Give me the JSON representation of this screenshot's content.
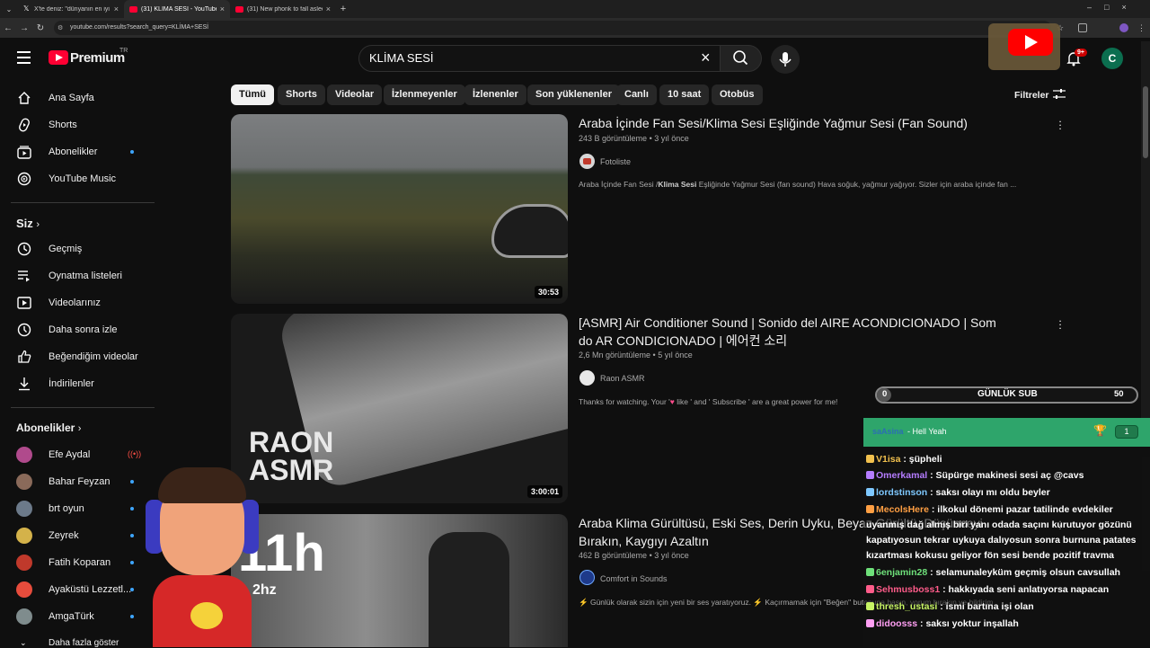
{
  "browser": {
    "tabs": [
      {
        "label": "X'te deniz: \"dünyanın en iyi oku",
        "active": false
      },
      {
        "label": "(31) KLİMA SESİ - YouTube",
        "active": true
      },
      {
        "label": "(31) New phonk to fall asleep t",
        "active": false
      }
    ],
    "url": "youtube.com/results?search_query=KLİMA+SESİ"
  },
  "header": {
    "logo_text": "Premium",
    "logo_region": "TR",
    "search_value": "KLİMA SESİ",
    "notification_count": "9+",
    "account_initial": "C"
  },
  "sidebar": {
    "main_items": [
      {
        "label": "Ana Sayfa",
        "icon": "home-icon"
      },
      {
        "label": "Shorts",
        "icon": "shorts-icon"
      },
      {
        "label": "Abonelikler",
        "icon": "subscriptions-icon",
        "dot": true
      },
      {
        "label": "YouTube Music",
        "icon": "music-icon"
      }
    ],
    "you_title": "Siz",
    "you_items": [
      {
        "label": "Geçmiş",
        "icon": "history-icon"
      },
      {
        "label": "Oynatma listeleri",
        "icon": "playlists-icon"
      },
      {
        "label": "Videolarınız",
        "icon": "your-videos-icon"
      },
      {
        "label": "Daha sonra izle",
        "icon": "watch-later-icon"
      },
      {
        "label": "Beğendiğim videolar",
        "icon": "liked-icon"
      },
      {
        "label": "İndirilenler",
        "icon": "downloads-icon"
      }
    ],
    "subs_title": "Abonelikler",
    "subs": [
      {
        "label": "Efe Aydal",
        "color": "#b04a8c",
        "live": true
      },
      {
        "label": "Bahar Feyzan",
        "color": "#8a6a5a",
        "dot": true
      },
      {
        "label": "brt oyun",
        "color": "#6c7a8a",
        "dot": true
      },
      {
        "label": "Zeyrek",
        "color": "#d4b24a",
        "dot": true
      },
      {
        "label": "Fatih Koparan",
        "color": "#c0392b",
        "dot": true
      },
      {
        "label": "Ayaküstü Lezzetl...",
        "color": "#e74c3c",
        "dot": true
      },
      {
        "label": "AmgaTürk",
        "color": "#7f8c8d",
        "dot": true
      }
    ],
    "show_more": "Daha fazla göster"
  },
  "chips": [
    "Tümü",
    "Shorts",
    "Videolar",
    "İzlenmeyenler",
    "İzlenenler",
    "Son yüklenenler",
    "Canlı",
    "10 saat",
    "Otobüs"
  ],
  "filters_label": "Filtreler",
  "videos": [
    {
      "title": "Araba İçinde Fan Sesi/Klima Sesi Eşliğinde Yağmur Sesi (Fan Sound)",
      "views": "243 B görüntüleme",
      "age": "3 yıl önce",
      "channel": "Fotoliste",
      "desc_pre": "Araba İçinde Fan Sesi /",
      "desc_bold": "Klima Sesi",
      "desc_post": " Eşliğinde Yağmur Sesi (fan sound) Hava soğuk, yağmur yağıyor. Sizler için araba içinde fan ...",
      "duration": "30:53"
    },
    {
      "title": "[ASMR] Air Conditioner Sound | Sonido del AIRE ACONDICIONADO | Som do AR CONDICIONADO | 에어컨 소리",
      "views": "2,6 Mn görüntüleme",
      "age": "5 yıl önce",
      "channel": "Raon ASMR",
      "desc_pre": "Thanks for watching. Your '",
      "desc_bold": "",
      "desc_post": " like ' and ' Subscribe ' are a great power for me!",
      "duration": "3:00:01",
      "thumb_text": "RAON\nASMR"
    },
    {
      "title": "Araba Klima Gürültüsü, Eski Ses, Derin Uyku, Beyaz Gürültü, Düşünceyi Bırakın, Kaygıyı Azaltın",
      "views": "462 B görüntüleme",
      "age": "3 yıl önce",
      "channel": "Comfort in Sounds",
      "desc_pre": "Günlük olarak sizin için yeni bir ses yaratıyoruz.",
      "desc_bold": "",
      "desc_post": "Kaçırmamak için \"Beğen\" butonuna basın, yorum bırakın ve bildirim",
      "thumb_text": "11h",
      "thumb_sub": "2hz"
    }
  ],
  "overlay": {
    "sub_goal_label": "GÜNLÜK SUB",
    "sub_current": "0",
    "sub_target": "50",
    "progress": 0.0,
    "chat_header_user": "saAsina",
    "chat_header_msg": "- Hell Yeah",
    "chat_header_count": "1",
    "messages": [
      {
        "user": "V1isa",
        "color": "#f2c14e",
        "text": "şüpheli"
      },
      {
        "user": "Omerkamal",
        "color": "#b57cff",
        "text": "Süpürge makinesi sesi aç @cavs"
      },
      {
        "user": "lordstinson",
        "color": "#7ec8ff",
        "text": "saksı olayı mı oldu beyler"
      },
      {
        "user": "MecolsHere",
        "color": "#ff9f43",
        "text": "ilkokul dönemi pazar tatilinde evdekiler uyanmış dağ almış biri yanı odada saçını kurutuyor gözünü kapatıyosun tekrar uykuya dalıyosun sonra burnuna patates kızartması kokusu geliyor fön sesi bende pozitif travma"
      },
      {
        "user": "6enjamin28",
        "color": "#6ee07a",
        "text": "selamunaleyküm geçmiş olsun cavsullah"
      },
      {
        "user": "Sehmusboss1",
        "color": "#ff5c8a",
        "text": "hakkıyada seni anlatıyorsa napacan"
      },
      {
        "user": "thresh_ustasi",
        "color": "#c7f464",
        "text": "ismi bartına işi olan"
      },
      {
        "user": "didoosss",
        "color": "#ff9ff3",
        "text": "saksı yoktur inşallah"
      }
    ]
  }
}
